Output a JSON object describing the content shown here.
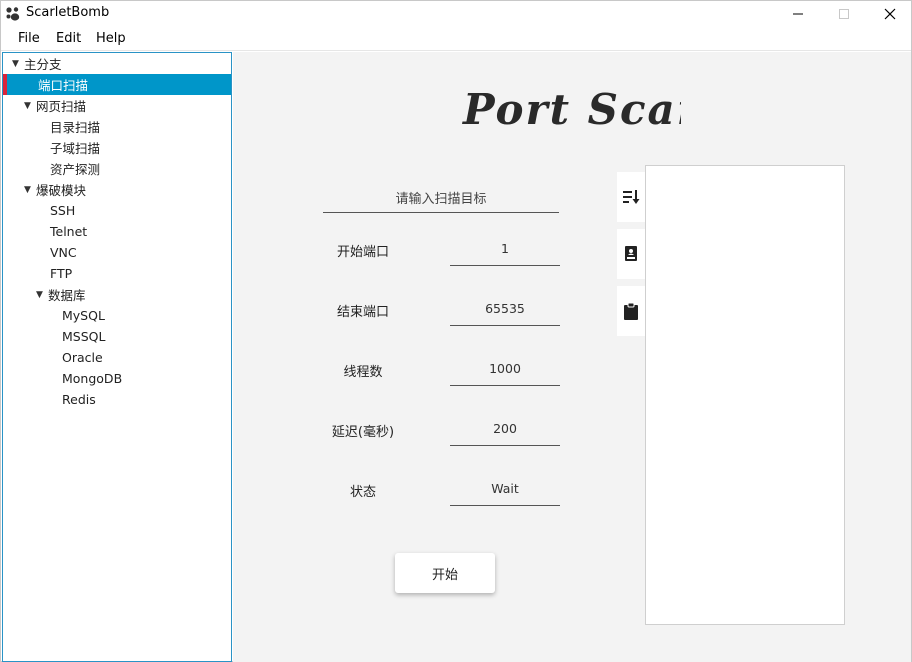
{
  "window": {
    "title": "ScarletBomb",
    "icon": "paw-icon"
  },
  "menu": [
    "File",
    "Edit",
    "Help"
  ],
  "tree": [
    {
      "label": "主分支",
      "level": 0,
      "expanded": true
    },
    {
      "label": "端口扫描",
      "level": 1,
      "selected": true
    },
    {
      "label": "网页扫描",
      "level": 1,
      "expanded": true
    },
    {
      "label": "目录扫描",
      "level": 2
    },
    {
      "label": "子域扫描",
      "level": 2
    },
    {
      "label": "资产探测",
      "level": 2
    },
    {
      "label": "爆破模块",
      "level": 1,
      "expanded": true
    },
    {
      "label": "SSH",
      "level": 2
    },
    {
      "label": "Telnet",
      "level": 2
    },
    {
      "label": "VNC",
      "level": 2
    },
    {
      "label": "FTP",
      "level": 2
    },
    {
      "label": "数据库",
      "level": 2,
      "expanded": true
    },
    {
      "label": "MySQL",
      "level": 3
    },
    {
      "label": "MSSQL",
      "level": 3
    },
    {
      "label": "Oracle",
      "level": 3
    },
    {
      "label": "MongoDB",
      "level": 3
    },
    {
      "label": "Redis",
      "level": 3
    }
  ],
  "page": {
    "title": "Port Scan",
    "target_placeholder": "请输入扫描目标",
    "fields": [
      {
        "label": "开始端口",
        "value": "1"
      },
      {
        "label": "结束端口",
        "value": "65535"
      },
      {
        "label": "线程数",
        "value": "1000"
      },
      {
        "label": "延迟(毫秒)",
        "value": "200"
      },
      {
        "label": "状态",
        "value": "Wait"
      }
    ],
    "start_button": "开始",
    "tools": [
      "sort-icon",
      "book-icon",
      "clipboard-icon"
    ]
  },
  "colors": {
    "selection": "#0096c9",
    "selection_marker": "#d9243a",
    "sidebar_border": "#2a93c6",
    "main_bg": "#f3f3f3"
  }
}
